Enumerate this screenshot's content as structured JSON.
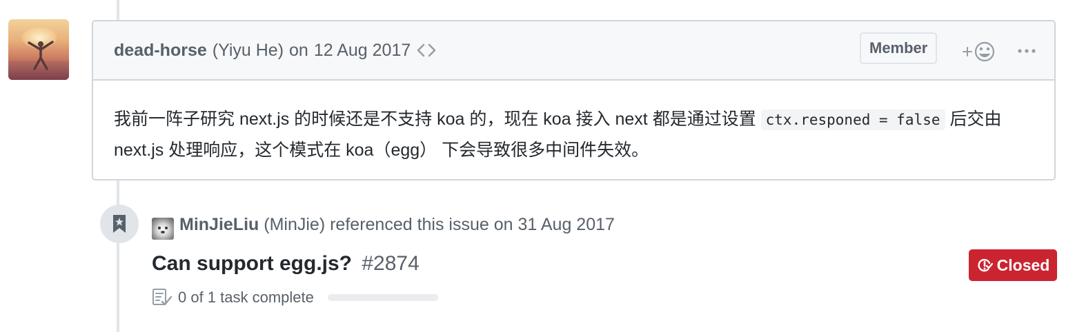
{
  "comment": {
    "author": "dead-horse",
    "full_name": "(Yiyu He)",
    "on_word": "on",
    "date": "12 Aug 2017",
    "role_badge": "Member",
    "body_text_1": "我前一阵子研究 next.js 的时候还是不支持 koa 的，现在 koa 接入 next 都是通过设置 ",
    "body_code": "ctx.responed = false",
    "body_text_2": " 后交由 next.js 处理响应，这个模式在 koa（egg） 下会导致很多中间件失效。"
  },
  "reference_event": {
    "author": "MinJieLiu",
    "full_name": "(MinJie)",
    "action_text": "referenced this issue on 31 Aug 2017",
    "issue_title": "Can support egg.js?",
    "issue_number": "#2874",
    "status_label": "Closed",
    "status_color": "#cb2431",
    "task_summary": "0 of 1 task complete",
    "task_progress": 0
  },
  "icons": {
    "edited": "code-brackets-icon",
    "reaction": "add-reaction-icon",
    "more": "kebab-icon",
    "reference": "bookmark-icon",
    "closed": "issue-closed-icon",
    "tasks": "checklist-icon"
  }
}
